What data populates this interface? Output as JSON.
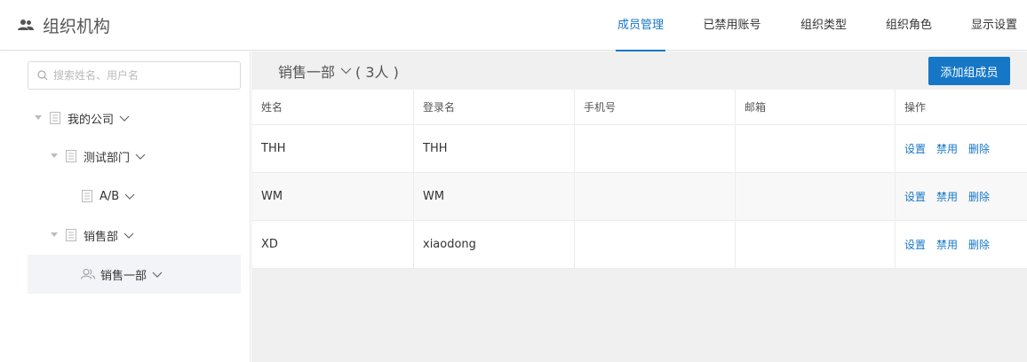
{
  "header": {
    "title": "组织机构",
    "icon": "users-icon",
    "nav": [
      {
        "label": "成员管理",
        "active": true
      },
      {
        "label": "已禁用账号",
        "active": false
      },
      {
        "label": "组织类型",
        "active": false
      },
      {
        "label": "组织角色",
        "active": false
      },
      {
        "label": "显示设置",
        "active": false
      }
    ]
  },
  "sidebar": {
    "search_placeholder": "搜索姓名、用户名",
    "tree": [
      {
        "label": "我的公司",
        "level": 0,
        "icon": "document-icon",
        "expandable": true
      },
      {
        "label": "测试部门",
        "level": 1,
        "icon": "document-icon",
        "expandable": true
      },
      {
        "label": "A/B",
        "level": 2,
        "icon": "document-icon",
        "expandable": false
      },
      {
        "label": "销售部",
        "level": 1,
        "icon": "document-icon",
        "expandable": true
      },
      {
        "label": "销售一部",
        "level": 2,
        "icon": "group-icon",
        "expandable": false,
        "selected": true
      }
    ]
  },
  "main": {
    "dept_name": "销售一部",
    "member_count": "( 3人 )",
    "add_button": "添加组成员",
    "table": {
      "columns": [
        "姓名",
        "登录名",
        "手机号",
        "邮箱",
        "操作"
      ],
      "rows": [
        {
          "name": "THH",
          "login": "THH",
          "phone": "",
          "email": ""
        },
        {
          "name": "WM",
          "login": "WM",
          "phone": "",
          "email": ""
        },
        {
          "name": "XD",
          "login": "xiaodong",
          "phone": "",
          "email": ""
        }
      ],
      "actions": [
        "设置",
        "禁用",
        "删除"
      ]
    }
  },
  "colors": {
    "accent": "#1677c7",
    "selected_bg": "#f2f4f7",
    "main_bg": "#f0f0f0"
  }
}
